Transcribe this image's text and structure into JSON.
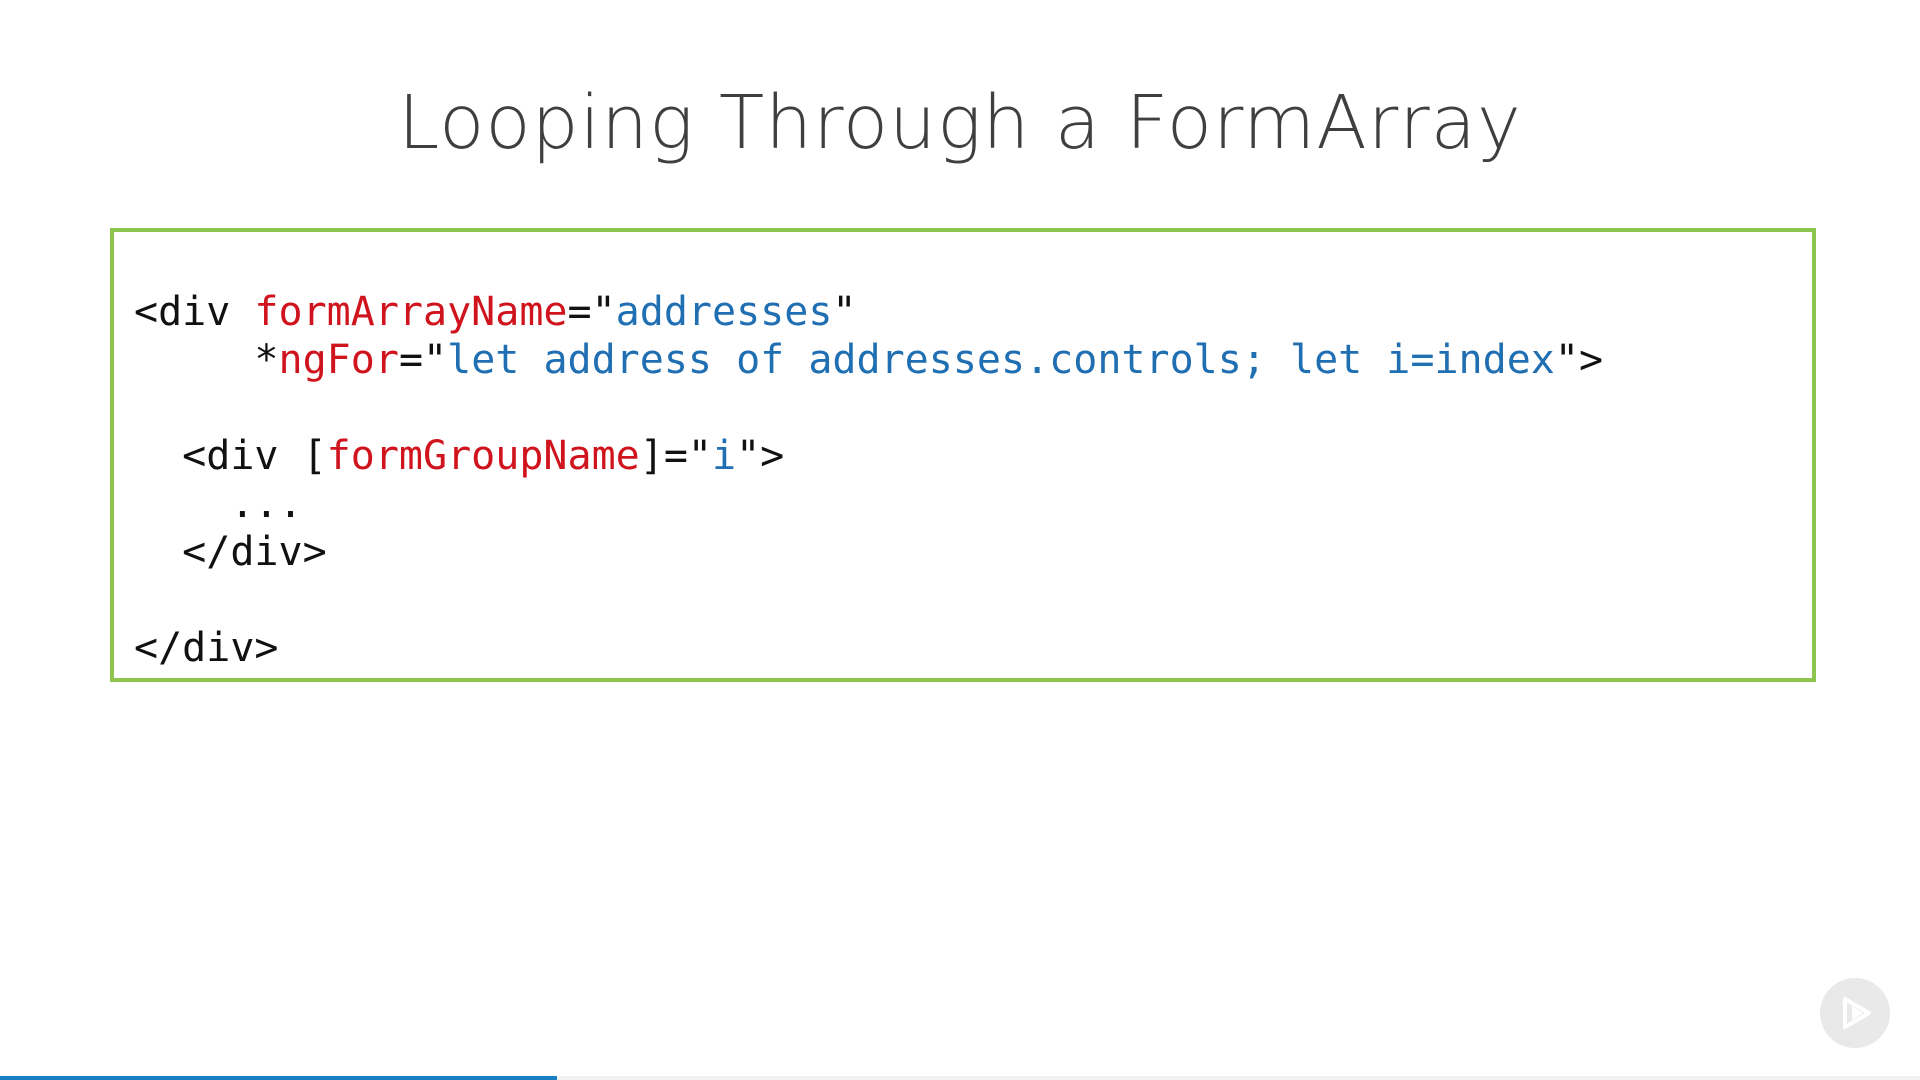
{
  "slide": {
    "title": "Looping Through a FormArray"
  },
  "code": {
    "line1": {
      "tag_open": "<div ",
      "attr": "formArrayName",
      "eq": "=\"",
      "value": "addresses",
      "close": "\""
    },
    "line2": {
      "indent": "     ",
      "star": "*",
      "attr": "ngFor",
      "eq": "=\"",
      "value": "let address of addresses.controls; let i=index",
      "close": "\">"
    },
    "line3": "",
    "line4": {
      "indent": "  ",
      "tag_open": "<div [",
      "attr": "formGroupName",
      "eq": "]=\"",
      "value": "i",
      "close": "\">"
    },
    "line5": "    ...",
    "line6": "  </div>",
    "line7": "",
    "line8": "</div>"
  },
  "colors": {
    "box_border": "#8dc44e",
    "attribute": "#d0141e",
    "value": "#1f6fb2",
    "progress": "#1a7ec4"
  },
  "player": {
    "play_icon": "play-icon",
    "progress_fraction": 0.29
  }
}
